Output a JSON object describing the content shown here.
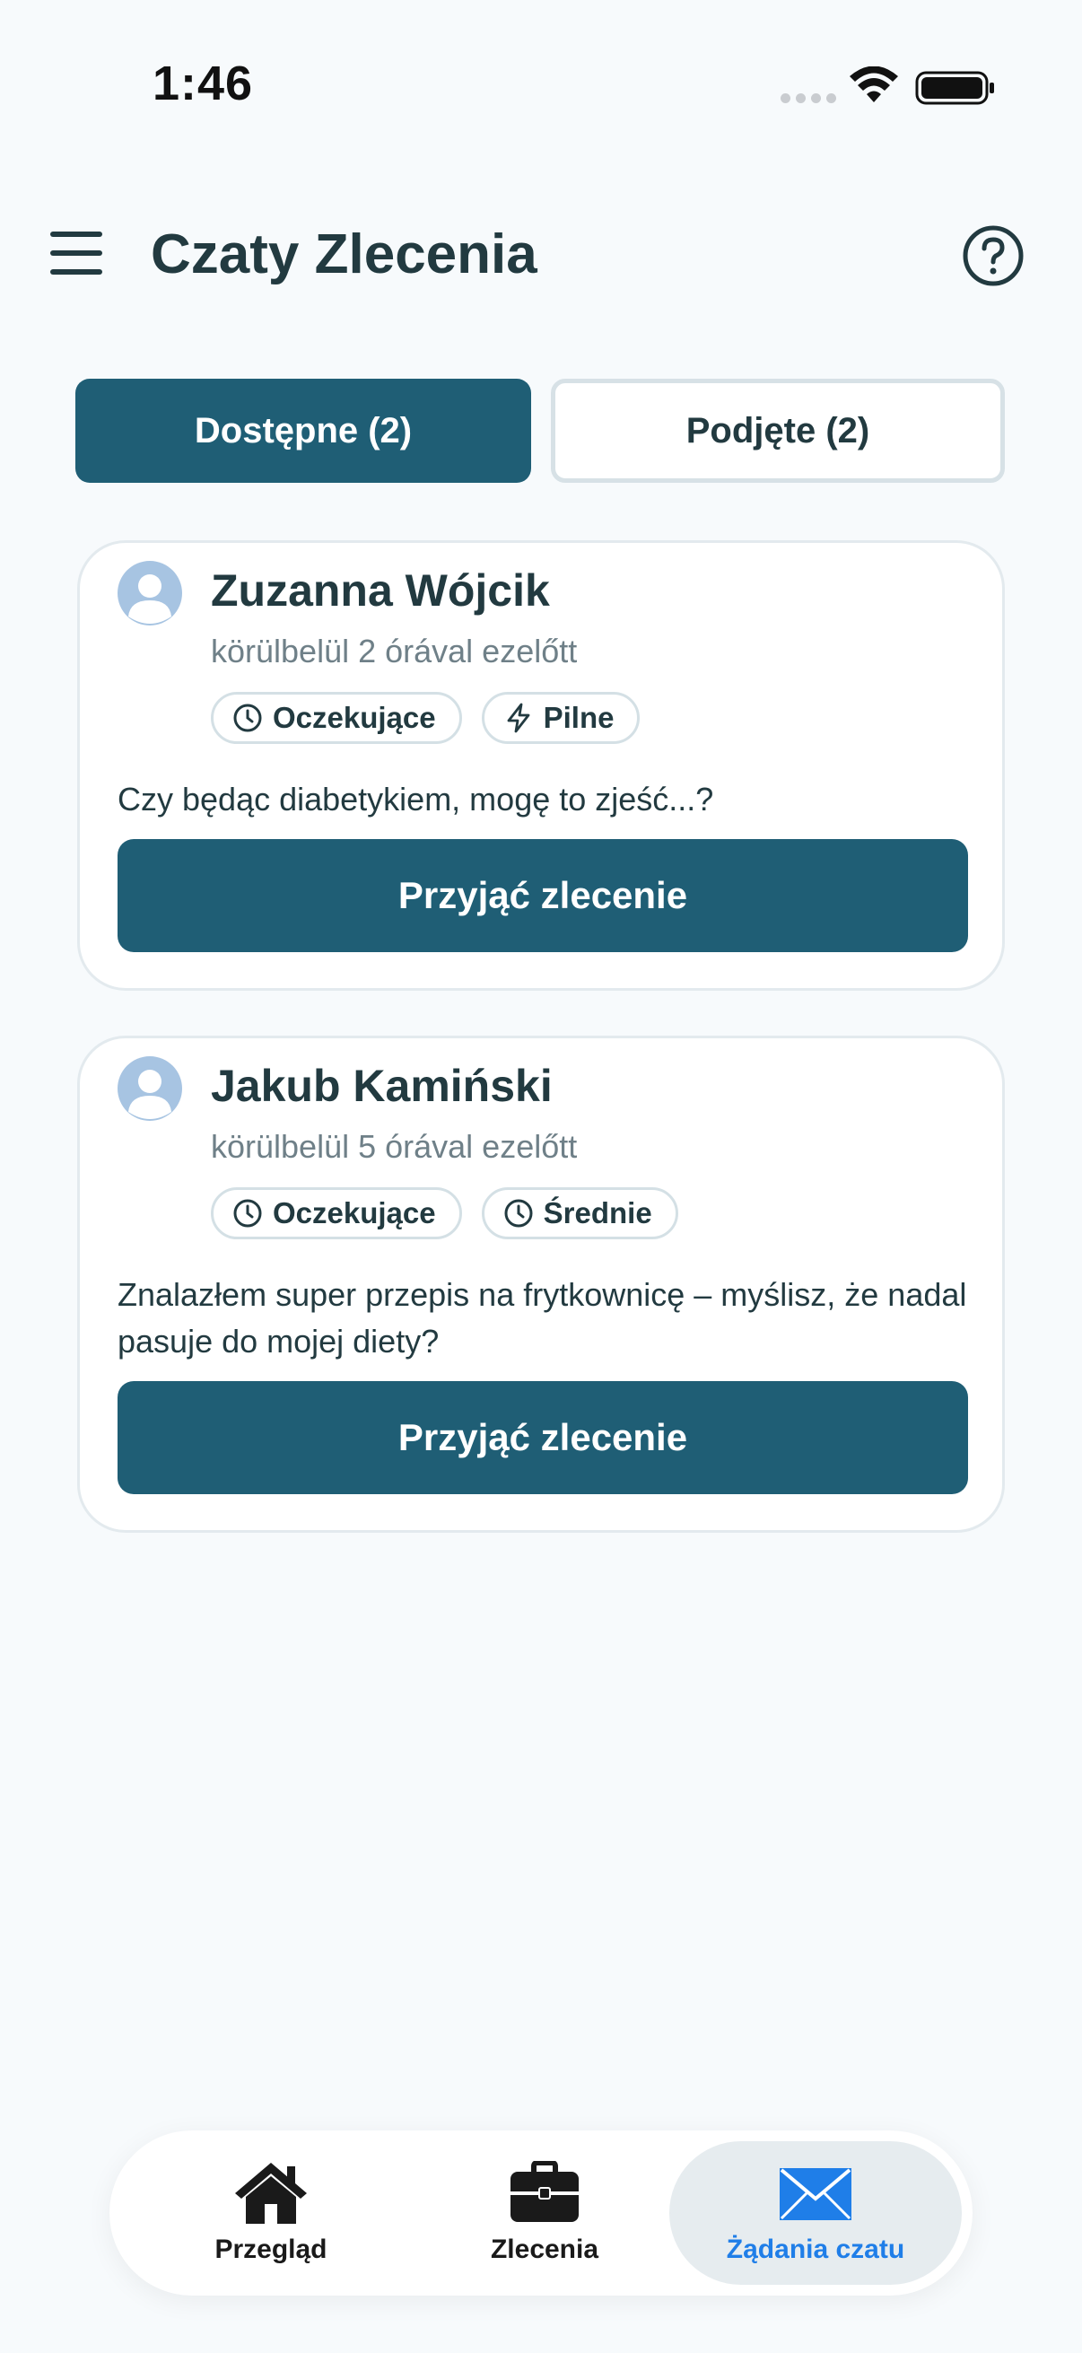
{
  "status_bar": {
    "time": "1:46"
  },
  "header": {
    "title": "Czaty Zlecenia"
  },
  "tabs": [
    {
      "label": "Dostępne (2)",
      "active": true
    },
    {
      "label": "Podjęte (2)",
      "active": false
    }
  ],
  "cards": [
    {
      "name": "Zuzanna Wójcik",
      "time": "körülbelül 2 órával ezelőtt",
      "badges": [
        {
          "icon": "clock-icon",
          "label": "Oczekujące"
        },
        {
          "icon": "lightning-icon",
          "label": "Pilne"
        }
      ],
      "message": "Czy będąc diabetykiem, mogę to zjeść...?",
      "button": "Przyjąć zlecenie"
    },
    {
      "name": "Jakub Kamiński",
      "time": "körülbelül 5 órával ezelőtt",
      "badges": [
        {
          "icon": "clock-icon",
          "label": "Oczekujące"
        },
        {
          "icon": "clock-icon",
          "label": "Średnie"
        }
      ],
      "message": "Znalazłem super przepis na frytkownicę – myślisz, że nadal pasuje do mojej diety?",
      "button": "Przyjąć zlecenie"
    }
  ],
  "bottom_nav": [
    {
      "icon": "home-icon",
      "label": "Przegląd",
      "active": false
    },
    {
      "icon": "briefcase-icon",
      "label": "Zlecenia",
      "active": false
    },
    {
      "icon": "envelope-icon",
      "label": "Żądania czatu",
      "active": true
    }
  ],
  "colors": {
    "primary": "#1f5e75",
    "active_nav": "#1f7ee8",
    "background": "#f7fafc"
  }
}
